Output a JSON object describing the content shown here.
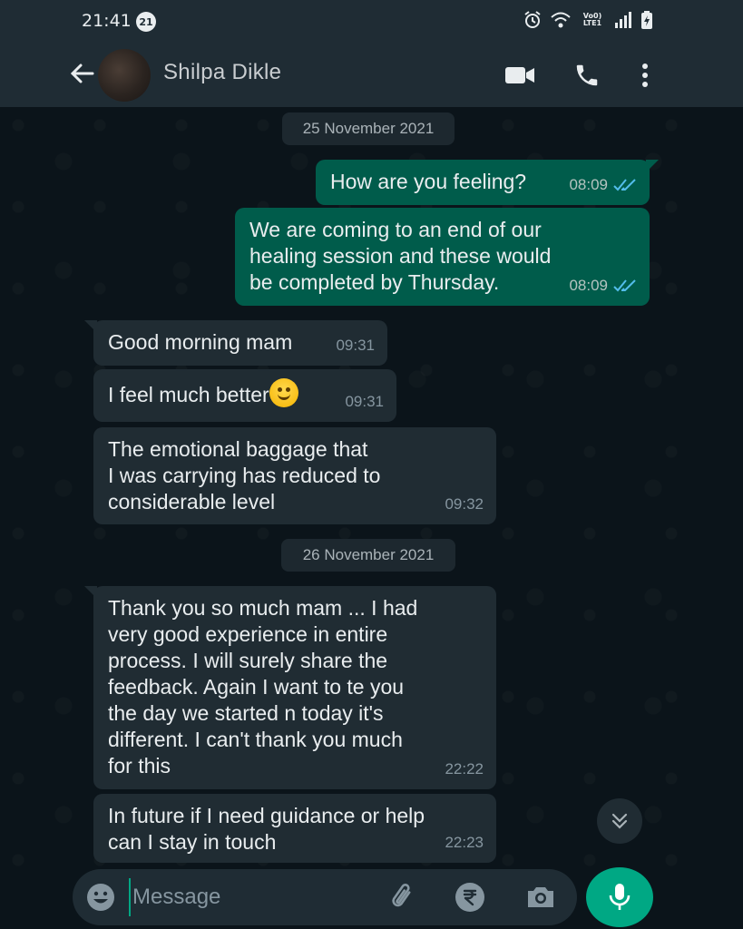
{
  "status_bar": {
    "time": "21:41",
    "notification_count": "21",
    "network_label": "Vo0) LTE1"
  },
  "header": {
    "contact_name": "Shilpa Dikle",
    "icons": [
      "back-arrow-icon",
      "avatar",
      "video-camera-icon",
      "phone-icon",
      "more-vert-icon"
    ]
  },
  "chat": {
    "date_1": "25 November 2021",
    "date_2": "26 November 2021",
    "messages": [
      {
        "direction": "out",
        "text": "How are you feeling?",
        "time": "08:09",
        "status": "read"
      },
      {
        "direction": "out",
        "lines": [
          "We are coming to an end of our",
          "healing session  and these would",
          "be completed by Thursday."
        ],
        "time": "08:09",
        "status": "read"
      },
      {
        "direction": "in",
        "text": "Good morning mam",
        "time": "09:31"
      },
      {
        "direction": "in",
        "text": "I feel much better",
        "emoji": "smiling-face",
        "time": "09:31"
      },
      {
        "direction": "in",
        "lines": [
          "The emotional baggage that",
          "I was carrying has reduced to",
          "considerable level"
        ],
        "time": "09:32"
      },
      {
        "direction": "in",
        "lines": [
          "Thank you so much mam ... I had",
          "very good experience in entire",
          "process. I will surely share the",
          "feedback. Again I want to te you",
          "the day we started n today it's",
          "different. I can't thank you much",
          "for this"
        ],
        "time": "22:22"
      },
      {
        "direction": "in",
        "lines": [
          "In future if I need guidance or help",
          "can I stay in touch"
        ],
        "time": "22:23"
      }
    ]
  },
  "input": {
    "placeholder": "Message",
    "value": ""
  },
  "colors": {
    "outgoing_bubble": "#005c4b",
    "incoming_bubble": "#202c33",
    "accent": "#00a884",
    "read_ticks": "#53bdeb",
    "background": "#0b141a"
  }
}
